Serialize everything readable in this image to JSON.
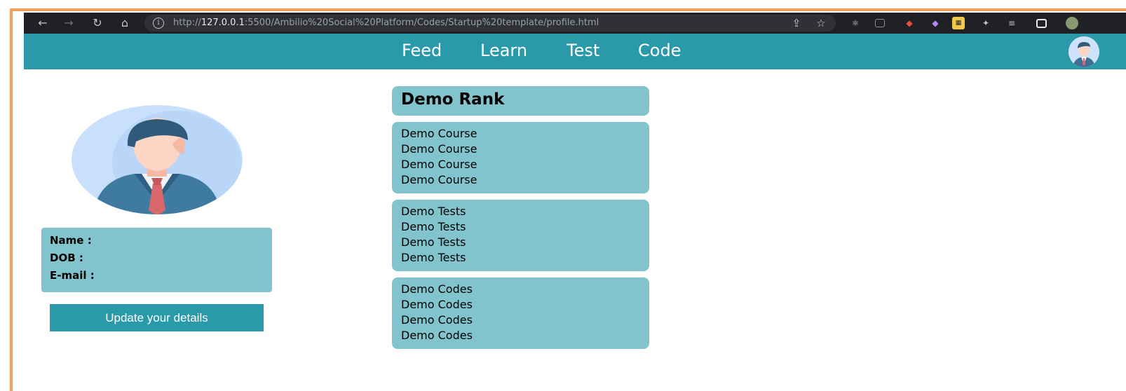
{
  "browser": {
    "url_prefix": "http://",
    "url_host": "127.0.0.1",
    "url_rest": ":5500/Ambilio%20Social%20Platform/Codes/Startup%20template/profile.html",
    "back_icon": "back-arrow-icon",
    "forward_icon": "forward-arrow-icon",
    "reload_icon": "reload-icon",
    "home_icon": "home-icon"
  },
  "nav": {
    "links": [
      "Feed",
      "Learn",
      "Test",
      "Code"
    ]
  },
  "profile": {
    "name_label": "Name :",
    "dob_label": "DOB :",
    "email_label": "E-mail :",
    "update_button": "Update your details"
  },
  "rank": {
    "title": "Demo Rank"
  },
  "courses": [
    "Demo Course",
    "Demo Course",
    "Demo Course",
    "Demo Course"
  ],
  "tests": [
    "Demo Tests",
    "Demo Tests",
    "Demo Tests",
    "Demo Tests"
  ],
  "codes": [
    "Demo Codes",
    "Demo Codes",
    "Demo Codes",
    "Demo Codes"
  ],
  "colors": {
    "nav_bg": "#2a9aab",
    "card_bg": "#81c4cd",
    "frame": "#f4a15d",
    "chrome_bg": "#202124"
  }
}
